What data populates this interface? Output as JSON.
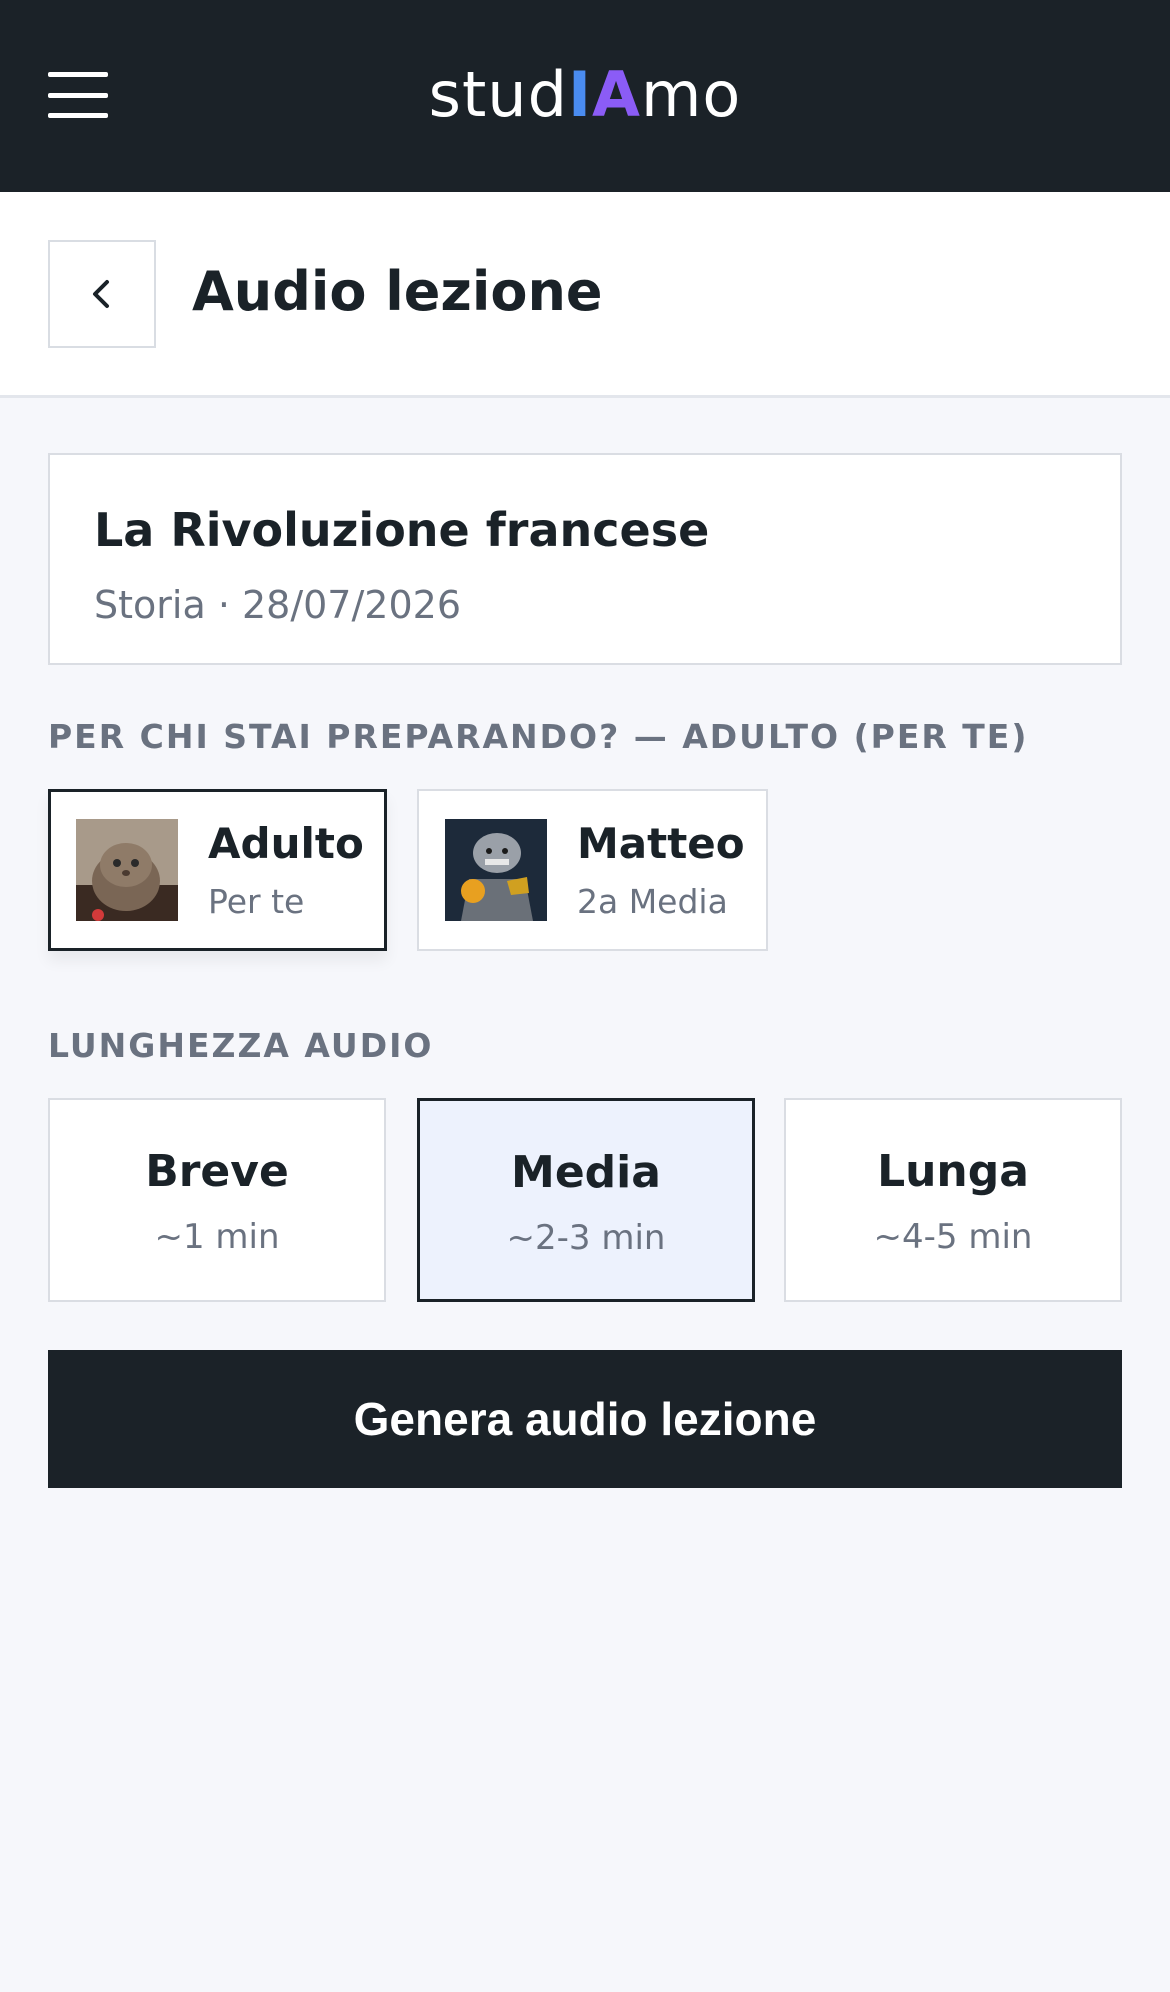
{
  "app": {
    "logo_prefix": "stud",
    "logo_i": "I",
    "logo_a": "A",
    "logo_suffix": "mo",
    "menu_icon": "hamburger-menu-icon"
  },
  "header": {
    "title": "Audio lezione",
    "back_icon": "chevron-left-icon"
  },
  "lesson": {
    "title": "La Rivoluzione francese",
    "meta": "Storia · 28/07/2026"
  },
  "audience": {
    "label": "PER CHI STAI PREPARANDO? — ADULTO (PER TE)",
    "profiles": [
      {
        "name": "Adulto",
        "subtitle": "Per te",
        "selected": true,
        "avatar_icon": "cat-avatar-icon"
      },
      {
        "name": "Matteo",
        "subtitle": "2a Media",
        "selected": false,
        "avatar_icon": "bulldog-avatar-icon"
      }
    ]
  },
  "length": {
    "label": "LUNGHEZZA AUDIO",
    "options": [
      {
        "title": "Breve",
        "duration": "~1 min",
        "selected": false
      },
      {
        "title": "Media",
        "duration": "~2-3 min",
        "selected": true
      },
      {
        "title": "Lunga",
        "duration": "~4-5 min",
        "selected": false
      }
    ]
  },
  "actions": {
    "generate_label": "Genera audio lezione"
  },
  "colors": {
    "topbar": "#1b2228",
    "accent_blue": "#4a8cf0",
    "accent_purple": "#8b5cf6",
    "selected_bg": "#edf2fd"
  }
}
